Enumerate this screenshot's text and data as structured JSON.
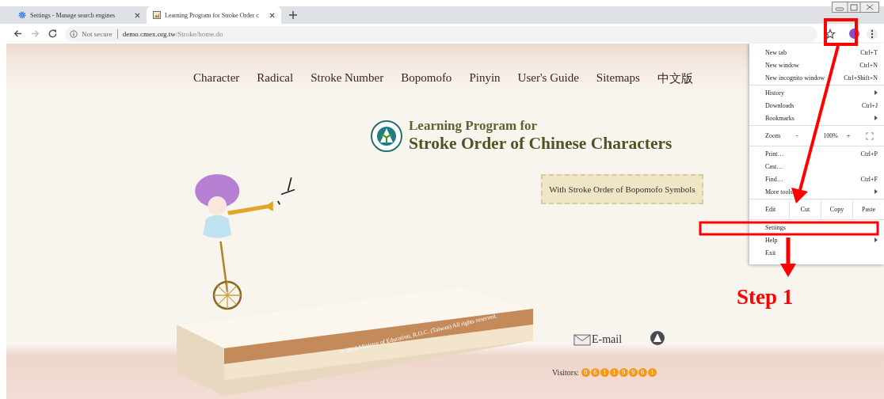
{
  "tabs": [
    {
      "title": "Settings - Manage search engines",
      "selected": false,
      "kind": "settings"
    },
    {
      "title": "Learning Program for Stroke Order c",
      "selected": true,
      "kind": "page"
    }
  ],
  "address": {
    "security": "Not secure",
    "host": "demo.cmex.org.tw",
    "path": "/Stroke/home.do"
  },
  "nav": [
    "Character",
    "Radical",
    "Stroke Number",
    "Bopomofo",
    "Pinyin",
    "User's Guide",
    "Sitemaps",
    "中文版"
  ],
  "heading": {
    "line1": "Learning Program for",
    "line2": "Stroke Order of Chinese Characters"
  },
  "banner": "With Stroke Order of Bopomofo Symbols",
  "copyright": "© 2010 Ministry of Education, R.O.C. (Taiwan) All rights reserved.",
  "email": "E-mail",
  "visitors": {
    "label": "Visitors:",
    "digits": [
      "0",
      "6",
      "1",
      "1",
      "9",
      "9",
      "6",
      "1"
    ]
  },
  "menu": {
    "sections": [
      [
        {
          "kind": "item",
          "label": "New tab",
          "shortcut": "Ctrl+T",
          "submenu": false
        },
        {
          "kind": "item",
          "label": "New window",
          "shortcut": "Ctrl+N",
          "submenu": false
        },
        {
          "kind": "item",
          "label": "New incognito window",
          "shortcut": "Ctrl+Shift+N",
          "submenu": false
        }
      ],
      [
        {
          "kind": "item",
          "label": "History",
          "submenu": true
        },
        {
          "kind": "item",
          "label": "Downloads",
          "shortcut": "Ctrl+J",
          "submenu": false
        },
        {
          "kind": "item",
          "label": "Bookmarks",
          "submenu": true
        }
      ],
      [
        {
          "kind": "zoom",
          "label": "Zoom",
          "minus": "-",
          "value": "100%",
          "plus": "+"
        }
      ],
      [
        {
          "kind": "item",
          "label": "Print…",
          "shortcut": "Ctrl+P",
          "submenu": false
        },
        {
          "kind": "item",
          "label": "Cast…",
          "submenu": false
        },
        {
          "kind": "item",
          "label": "Find…",
          "shortcut": "Ctrl+F",
          "submenu": false
        },
        {
          "kind": "item",
          "label": "More tools",
          "submenu": true
        }
      ],
      [
        {
          "kind": "edit",
          "label": "Edit",
          "actions": [
            "Cut",
            "Copy",
            "Paste"
          ]
        }
      ],
      [
        {
          "kind": "item",
          "label": "Settings",
          "submenu": false
        },
        {
          "kind": "item",
          "label": "Help",
          "submenu": true
        },
        {
          "kind": "item",
          "label": "Exit",
          "submenu": false
        }
      ]
    ]
  },
  "annotation": {
    "step": "Step 1"
  }
}
